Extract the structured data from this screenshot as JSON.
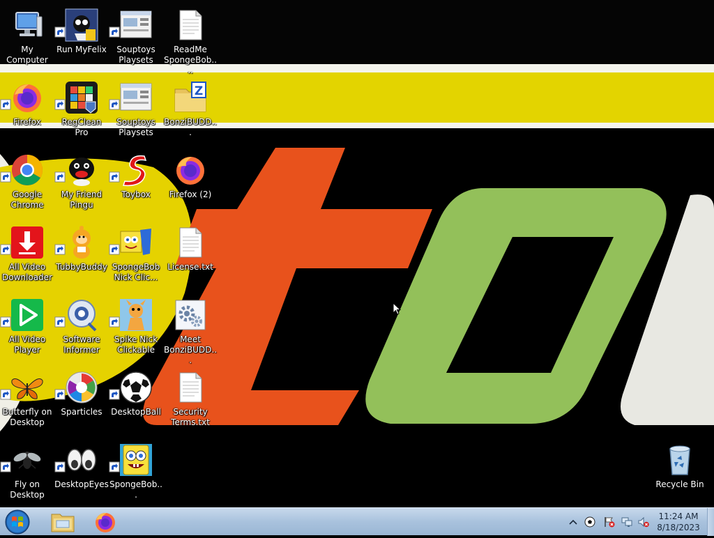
{
  "desktop": {
    "icons": [
      {
        "name": "my-computer-icon",
        "label": "My Computer",
        "shortcut": false
      },
      {
        "name": "run-myfelix-icon",
        "label": "Run MyFelix",
        "shortcut": true
      },
      {
        "name": "souptoys-playsets-icon",
        "label": "Souptoys Playsets",
        "shortcut": true
      },
      {
        "name": "readme-text-file-icon",
        "label": "ReadMe SpongeBob....",
        "shortcut": false
      },
      {
        "name": "firefox-icon",
        "label": "Firefox",
        "shortcut": true
      },
      {
        "name": "regclean-pro-icon",
        "label": "RegClean Pro",
        "shortcut": true
      },
      {
        "name": "souptoys-playsets-icon",
        "label": "Souptoys Playsets",
        "shortcut": true
      },
      {
        "name": "zip-folder-icon",
        "label": "BonziBUDD...",
        "shortcut": false
      },
      {
        "name": "google-chrome-icon",
        "label": "Google Chrome",
        "shortcut": true
      },
      {
        "name": "pingu-icon",
        "label": "My Friend Pingu",
        "shortcut": true
      },
      {
        "name": "toybox-icon",
        "label": "Toybox",
        "shortcut": true
      },
      {
        "name": "firefox-icon",
        "label": "Firefox (2)",
        "shortcut": false
      },
      {
        "name": "download-arrow-icon",
        "label": "All Video Downloader",
        "shortcut": true
      },
      {
        "name": "tubbybuddy-icon",
        "label": "TubbyBuddy",
        "shortcut": true
      },
      {
        "name": "spongebob-nick-icon",
        "label": "SpongeBob Nick Clic...",
        "shortcut": true
      },
      {
        "name": "text-file-icon",
        "label": "License.txt",
        "shortcut": false
      },
      {
        "name": "play-button-icon",
        "label": "All Video Player",
        "shortcut": true
      },
      {
        "name": "software-informer-icon",
        "label": "Software Informer",
        "shortcut": true
      },
      {
        "name": "spike-nick-icon",
        "label": "Spike Nick Clickable",
        "shortcut": true
      },
      {
        "name": "settings-gears-icon",
        "label": "Meet BonziBUDD...",
        "shortcut": false
      },
      {
        "name": "butterfly-icon",
        "label": "Butterfly on Desktop",
        "shortcut": true
      },
      {
        "name": "sparticles-icon",
        "label": "Sparticles",
        "shortcut": true
      },
      {
        "name": "soccer-ball-icon",
        "label": "DesktopBall",
        "shortcut": true
      },
      {
        "name": "text-file-icon",
        "label": "Security Terms.txt",
        "shortcut": false
      },
      {
        "name": "fly-icon",
        "label": "Fly on Desktop",
        "shortcut": true
      },
      {
        "name": "eyes-icon",
        "label": "DesktopEyes",
        "shortcut": true
      },
      {
        "name": "spongebob-icon",
        "label": "SpongeBob...",
        "shortcut": true
      },
      {
        "name": "recycle-bin-icon",
        "label": "Recycle Bin",
        "shortcut": false
      }
    ]
  },
  "taskbar": {
    "start": {
      "icon": "windows-orb-icon"
    },
    "pinned": [
      {
        "name": "file-explorer-icon"
      },
      {
        "name": "firefox-icon"
      }
    ],
    "tray": [
      {
        "name": "show-hidden-icons-chevron-icon"
      },
      {
        "name": "soccer-ball-tray-icon"
      },
      {
        "name": "action-center-flag-icon"
      },
      {
        "name": "network-icon"
      },
      {
        "name": "volume-muted-icon"
      }
    ],
    "clock": {
      "time": "11:24 AM",
      "date": "8/18/2023"
    }
  },
  "colors": {
    "wallpaper_yellow": "#e3d400",
    "wallpaper_orange": "#e8521c",
    "wallpaper_green": "#93c05a",
    "taskbar": "#b4cbe4"
  }
}
